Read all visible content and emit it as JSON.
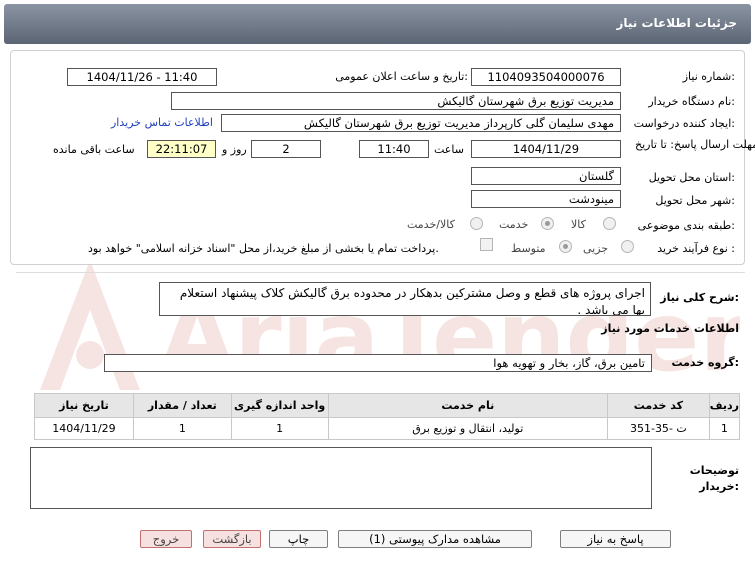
{
  "header": {
    "title": "جزئیات اطلاعات نیاز"
  },
  "form": {
    "need_number_label": "شماره نیاز:",
    "need_number": "1104093504000076",
    "announce_label": "تاریخ و ساعت اعلان عمومی:",
    "announce_value": "1404/11/26 - 11:40",
    "buyer_org_label": "نام دستگاه خریدار:",
    "buyer_org": "مدیریت توزیع برق شهرستان گالیکش",
    "creator_label": "ایجاد کننده درخواست:",
    "creator": "مهدی سلیمان گلی کارپرداز مدیریت توزیع برق شهرستان گالیکش",
    "contact_link": "اطلاعات تماس خریدار",
    "deadline_label": "مهلت ارسال پاسخ: تا تاریخ:",
    "deadline_date": "1404/11/29",
    "time_label": "ساعت",
    "deadline_time": "11:40",
    "days": "2",
    "days_label": "روز و",
    "remaining_time": "22:11:07",
    "remaining_label": "ساعت باقی مانده",
    "province_label": "استان محل تحویل:",
    "province": "گلستان",
    "city_label": "شهر محل تحویل:",
    "city": "مینودشت",
    "category_label": "طبقه بندی موضوعی:",
    "category_options": [
      "کالا",
      "خدمت",
      "کالا/خدمت"
    ],
    "process_label": "نوع فرآیند خرید :",
    "process_options": [
      "جزیی",
      "متوسط"
    ],
    "payment_note": "پرداخت تمام یا بخشی از مبلغ خرید،از محل \"اسناد خزانه اسلامی\" خواهد بود."
  },
  "summary": {
    "label": "شرح کلی نیاز:",
    "text": "اجرای پروژه های قطع و وصل مشترکین بدهکار در محدوده برق گالیکش کلاک پیشنهاد استعلام بها می باشد ."
  },
  "services": {
    "title": "اطلاعات خدمات مورد نیاز",
    "group_label": "گروه خدمت:",
    "group_value": "تامین برق، گاز، بخار و تهویه هوا",
    "columns": [
      "ردیف",
      "کد خدمت",
      "نام خدمت",
      "واحد اندازه گیری",
      "تعداد / مقدار",
      "تاریخ نیاز"
    ],
    "rows": [
      [
        "1",
        "ت -35-351",
        "تولید، انتقال و توزیع برق",
        "1",
        "1",
        "1404/11/29"
      ]
    ]
  },
  "notes": {
    "label_line1": "توضیحات",
    "label_line2": "خریدار:"
  },
  "buttons": {
    "reply": "پاسخ به نیاز",
    "attachments": "مشاهده مدارک پیوستی (1)",
    "print": "چاپ",
    "back": "بازگشت",
    "exit": "خروج"
  },
  "watermark": {
    "text": "AriaTender.net"
  },
  "colors": {
    "header": "#6f7886",
    "link": "#1f3fbf",
    "highlight": "#ffffc8",
    "watermark": "#c0392b"
  }
}
